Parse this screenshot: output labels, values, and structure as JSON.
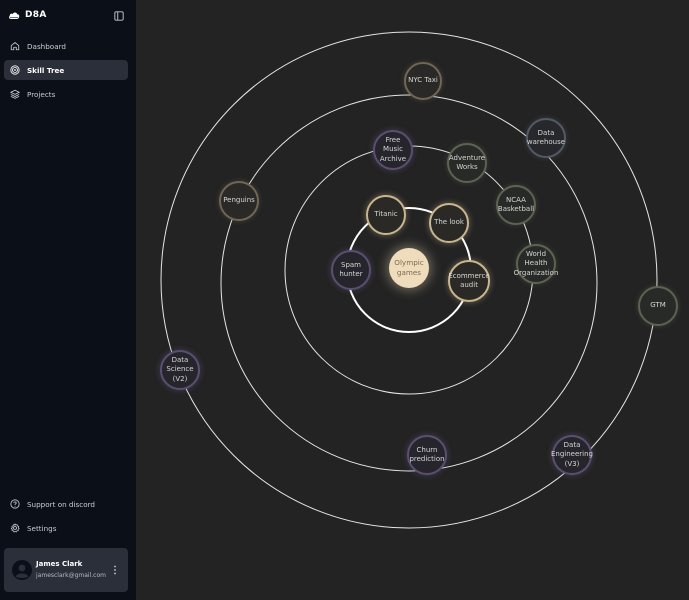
{
  "app": {
    "brand_name": "D8A"
  },
  "sidebar": {
    "nav": [
      {
        "label": "Dashboard",
        "icon": "home-icon"
      },
      {
        "label": "Skill Tree",
        "icon": "target-icon",
        "active": true
      },
      {
        "label": "Projects",
        "icon": "layers-icon"
      }
    ],
    "bottom": [
      {
        "label": "Support on discord",
        "icon": "help-circle-icon"
      },
      {
        "label": "Settings",
        "icon": "gear-icon"
      }
    ]
  },
  "user": {
    "name": "James Clark",
    "email": "jamesclark@gmail.com"
  },
  "skill_tree": {
    "nodes": [
      {
        "id": "olympic-games",
        "label": "Olympic\ngames"
      },
      {
        "id": "titanic",
        "label": "Titanic"
      },
      {
        "id": "the-look",
        "label": "The look"
      },
      {
        "id": "spam-hunter",
        "label": "Spam\nhunter"
      },
      {
        "id": "ecommerce-audit",
        "label": "Ecommerce\naudit"
      },
      {
        "id": "free-music-archive",
        "label": "Free\nMusic\nArchive"
      },
      {
        "id": "adventure-works",
        "label": "Adventure\nWorks"
      },
      {
        "id": "ncaa-basketball",
        "label": "NCAA\nBasketball"
      },
      {
        "id": "world-health-organization",
        "label": "World\nHealth\nOrganization"
      },
      {
        "id": "nyc-taxi",
        "label": "NYC Taxi"
      },
      {
        "id": "data-warehouse",
        "label": "Data\nwarehouse"
      },
      {
        "id": "penguins",
        "label": "Penguins"
      },
      {
        "id": "churn-prediction",
        "label": "Churn\nprediction"
      },
      {
        "id": "gtm",
        "label": "GTM"
      },
      {
        "id": "data-science-v2",
        "label": "Data\nScience\n(V2)"
      },
      {
        "id": "data-engineering-v3",
        "label": "Data\nEngineering\n(V3)"
      }
    ]
  }
}
